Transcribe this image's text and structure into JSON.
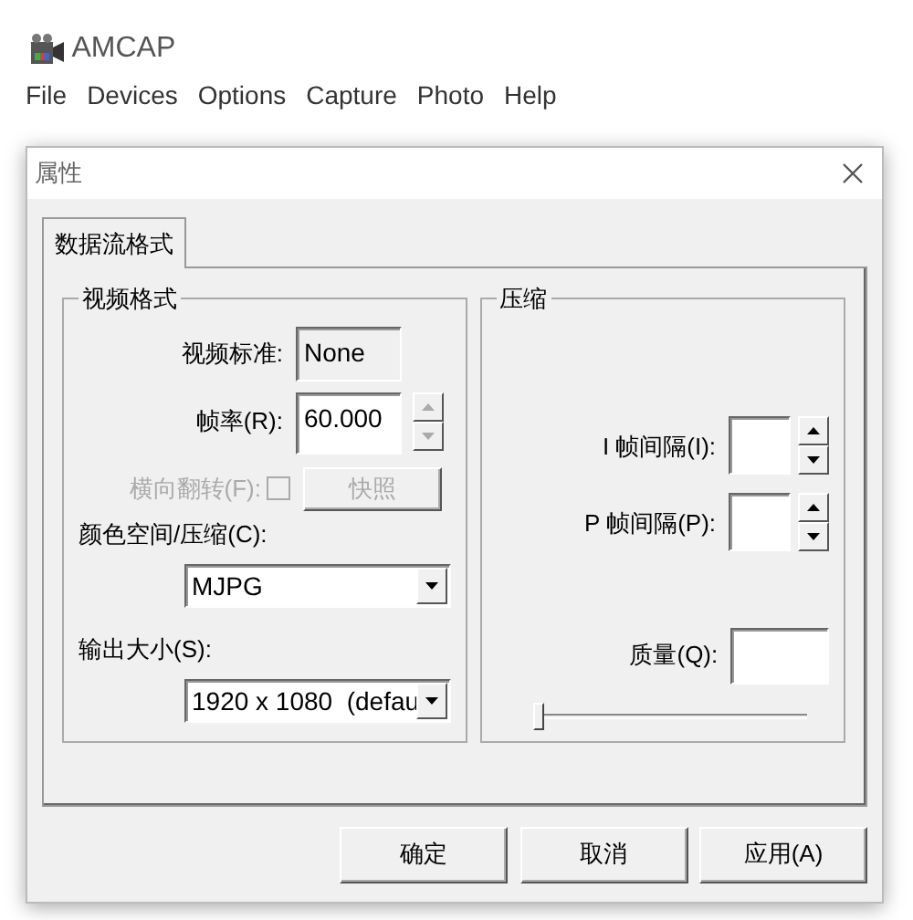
{
  "app": {
    "title": "AMCAP"
  },
  "menu": [
    "File",
    "Devices",
    "Options",
    "Capture",
    "Photo",
    "Help"
  ],
  "dialog": {
    "title": "属性",
    "tabs": [
      {
        "label": "数据流格式",
        "selected": true
      }
    ],
    "video_format": {
      "title": "视频格式",
      "standard": {
        "label": "视频标准:",
        "value": "None"
      },
      "frame_rate": {
        "label": "帧率(R):",
        "value": "60.000"
      },
      "flip": {
        "label": "横向翻转(F):",
        "checked": false,
        "disabled": true
      },
      "snapshot_button": {
        "label": "快照",
        "disabled": true
      },
      "color_space": {
        "label": "颜色空间/压缩(C):",
        "value": "MJPG"
      },
      "output_size": {
        "label": "输出大小(S):",
        "value": "1920 x 1080  (defau"
      }
    },
    "compression": {
      "title": "压缩",
      "i_frame": {
        "label": "I 帧间隔(I):"
      },
      "p_frame": {
        "label": "P 帧间隔(P):"
      },
      "quality": {
        "label": "质量(Q):",
        "level": 0
      }
    },
    "buttons": [
      "确定",
      "取消",
      "应用(A)"
    ]
  }
}
